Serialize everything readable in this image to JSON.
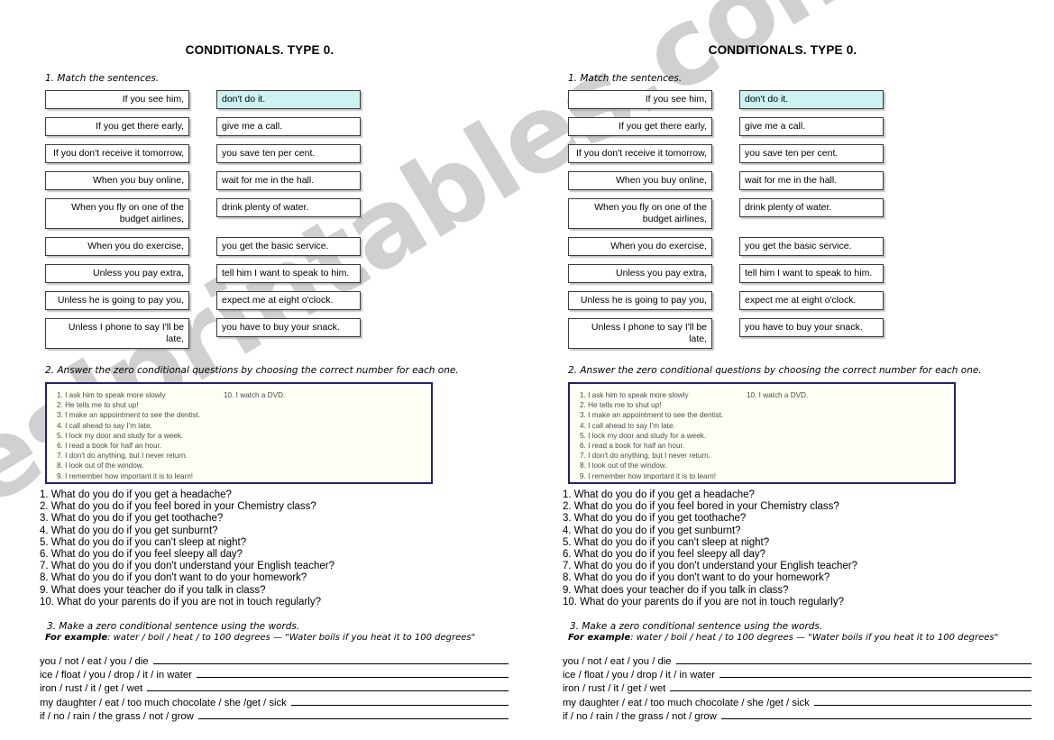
{
  "watermark": {
    "text": "eslprintables.com"
  },
  "colors": {
    "highlight": "#ccf2f2",
    "answer_box_border": "#20207a",
    "answer_box_fill": "#fffef5",
    "cell_border": "#3c3c3c"
  },
  "worksheet": {
    "title": "CONDITIONALS. TYPE 0.",
    "section1": {
      "heading": "1. Match the sentences.",
      "pairs": [
        {
          "left": "If you see him,",
          "right": "don't do it.",
          "highlighted": true
        },
        {
          "left": "If you get there early,",
          "right": "give me a call.",
          "highlighted": false
        },
        {
          "left": "If you don't receive it tomorrow,",
          "right": "you save ten per cent.",
          "highlighted": false
        },
        {
          "left": "When you buy online,",
          "right": "wait for me in the hall.",
          "highlighted": false
        },
        {
          "left": "When you fly on one of the budget airlines,",
          "right": "drink plenty of water.",
          "highlighted": false
        },
        {
          "left": "When you do exercise,",
          "right": "you get the basic service.",
          "highlighted": false
        },
        {
          "left": "Unless you pay extra,",
          "right": "tell him I want to speak to him.",
          "highlighted": false
        },
        {
          "left": "Unless he is going to pay you,",
          "right": "expect me at eight o'clock.",
          "highlighted": false
        },
        {
          "left": "Unless I phone to say I'll be late,",
          "right": "you have to buy your snack.",
          "highlighted": false
        }
      ]
    },
    "section2": {
      "heading": "2. Answer the zero conditional questions by choosing the correct number for each one.",
      "answers_column1": [
        "1. I ask him to speak more slowly",
        "2. He tells me to shut up!",
        "3. I make an appointment to see the dentist.",
        "4. I call ahead to say I'm late.",
        "5. I lock my door and study for a week.",
        "6. I read a book for half an hour.",
        "7. I don't do anything, but I never return.",
        "8. I look out of the window.",
        "9. I remember how important it is to learn!"
      ],
      "answers_column2": [
        "10. I watch a DVD."
      ],
      "questions": [
        "1. What do you do if you get a headache?",
        "2. What do you do if you feel bored in your Chemistry class?",
        "3. What do you do if you get toothache?",
        "4. What do you do if you get sunburnt?",
        "5. What do you do if you can't sleep at night?",
        "6. What do you do if you feel sleepy all day?",
        "7. What do you do if you don't understand your English teacher?",
        "8. What do you do if you don't want to do your homework?",
        "9. What does your teacher do if you talk in class?",
        "10. What do your parents do if you are not in touch regularly?"
      ]
    },
    "section3": {
      "heading": "3. Make a zero conditional sentence using the words.",
      "example_label": "For example",
      "example_text": ": water / boil / heat / to 100 degrees — \"Water boils if you heat it to 100 degrees\"",
      "prompts": [
        "you / not / eat / you / die",
        "ice / float / you / drop / it / in water",
        "iron / rust / it / get / wet",
        "my daughter / eat / too much chocolate / she /get / sick",
        "if / no / rain / the grass / not / grow"
      ]
    }
  }
}
